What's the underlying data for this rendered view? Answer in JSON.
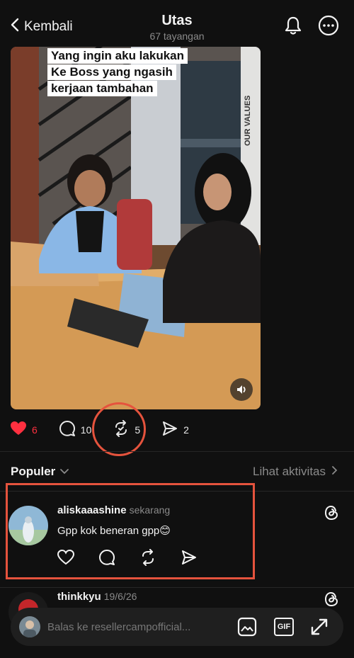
{
  "header": {
    "back_label": "Kembali",
    "title": "Utas",
    "views": "67 tayangan"
  },
  "post": {
    "caption_lines": [
      "Yang ingin aku lakukan",
      "Ke Boss yang ngasih",
      "kerjaan tambahan"
    ],
    "wall_text": "OUR VALUES",
    "likes": "6",
    "replies": "10",
    "reposts": "5",
    "shares": "2"
  },
  "section": {
    "title": "Populer",
    "activity_link": "Lihat aktivitas"
  },
  "comments": [
    {
      "username": "aliskaaashine",
      "time": "sekarang",
      "text": "Gpp kok beneran gpp😊"
    },
    {
      "username": "thinkkyu",
      "time": "19/6/26",
      "text": ""
    }
  ],
  "reply_bar": {
    "placeholder": "Balas ke resellercampofficial...",
    "gif_label": "GIF"
  },
  "colors": {
    "background": "#101010",
    "like": "#ff3040",
    "highlight": "#e5533d"
  },
  "icons": [
    "chevron-left-icon",
    "bell-icon",
    "more-icon",
    "heart-icon",
    "comment-icon",
    "repost-icon",
    "send-icon",
    "threads-icon",
    "image-icon",
    "gif-icon",
    "expand-icon",
    "speaker-icon"
  ]
}
